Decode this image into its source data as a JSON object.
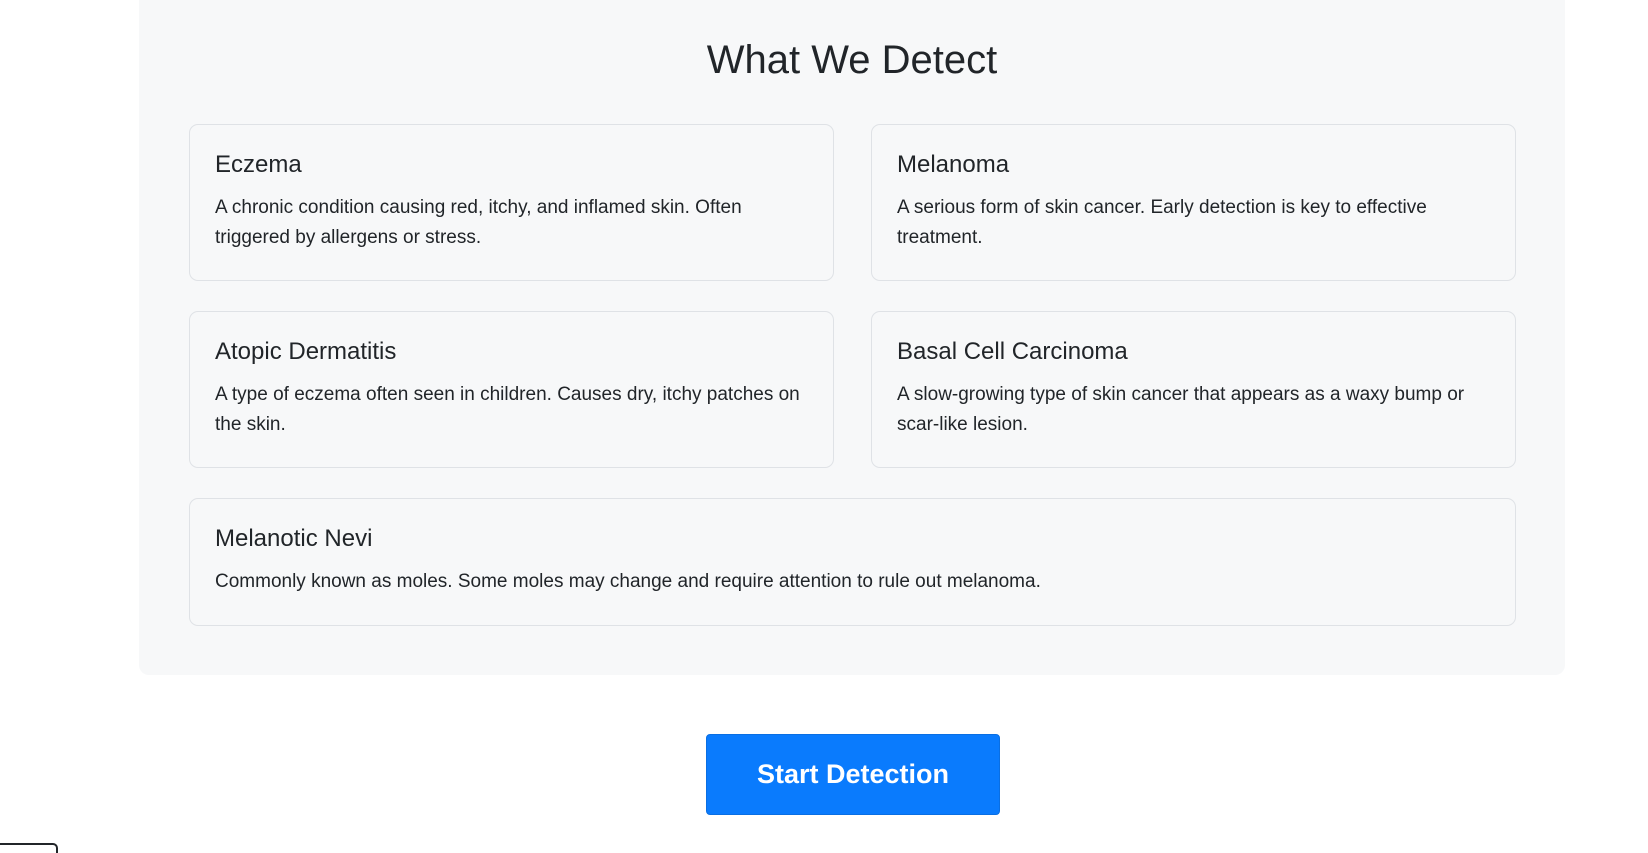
{
  "section": {
    "title": "What We Detect",
    "cards": [
      {
        "title": "Eczema",
        "description": "A chronic condition causing red, itchy, and inflamed skin. Often triggered by allergens or stress."
      },
      {
        "title": "Melanoma",
        "description": "A serious form of skin cancer. Early detection is key to effective treatment."
      },
      {
        "title": "Atopic Dermatitis",
        "description": "A type of eczema often seen in children. Causes dry, itchy patches on the skin."
      },
      {
        "title": "Basal Cell Carcinoma",
        "description": "A slow-growing type of skin cancer that appears as a waxy bump or scar-like lesion."
      },
      {
        "title": "Melanotic Nevi",
        "description": "Commonly known as moles. Some moles may change and require attention to rule out melanoma."
      }
    ]
  },
  "actions": {
    "start_label": "Start Detection"
  },
  "colors": {
    "primary": "#0a7bfd",
    "panel_background": "#f7f8f9",
    "card_border": "#dfe2e6",
    "text": "#212529"
  }
}
